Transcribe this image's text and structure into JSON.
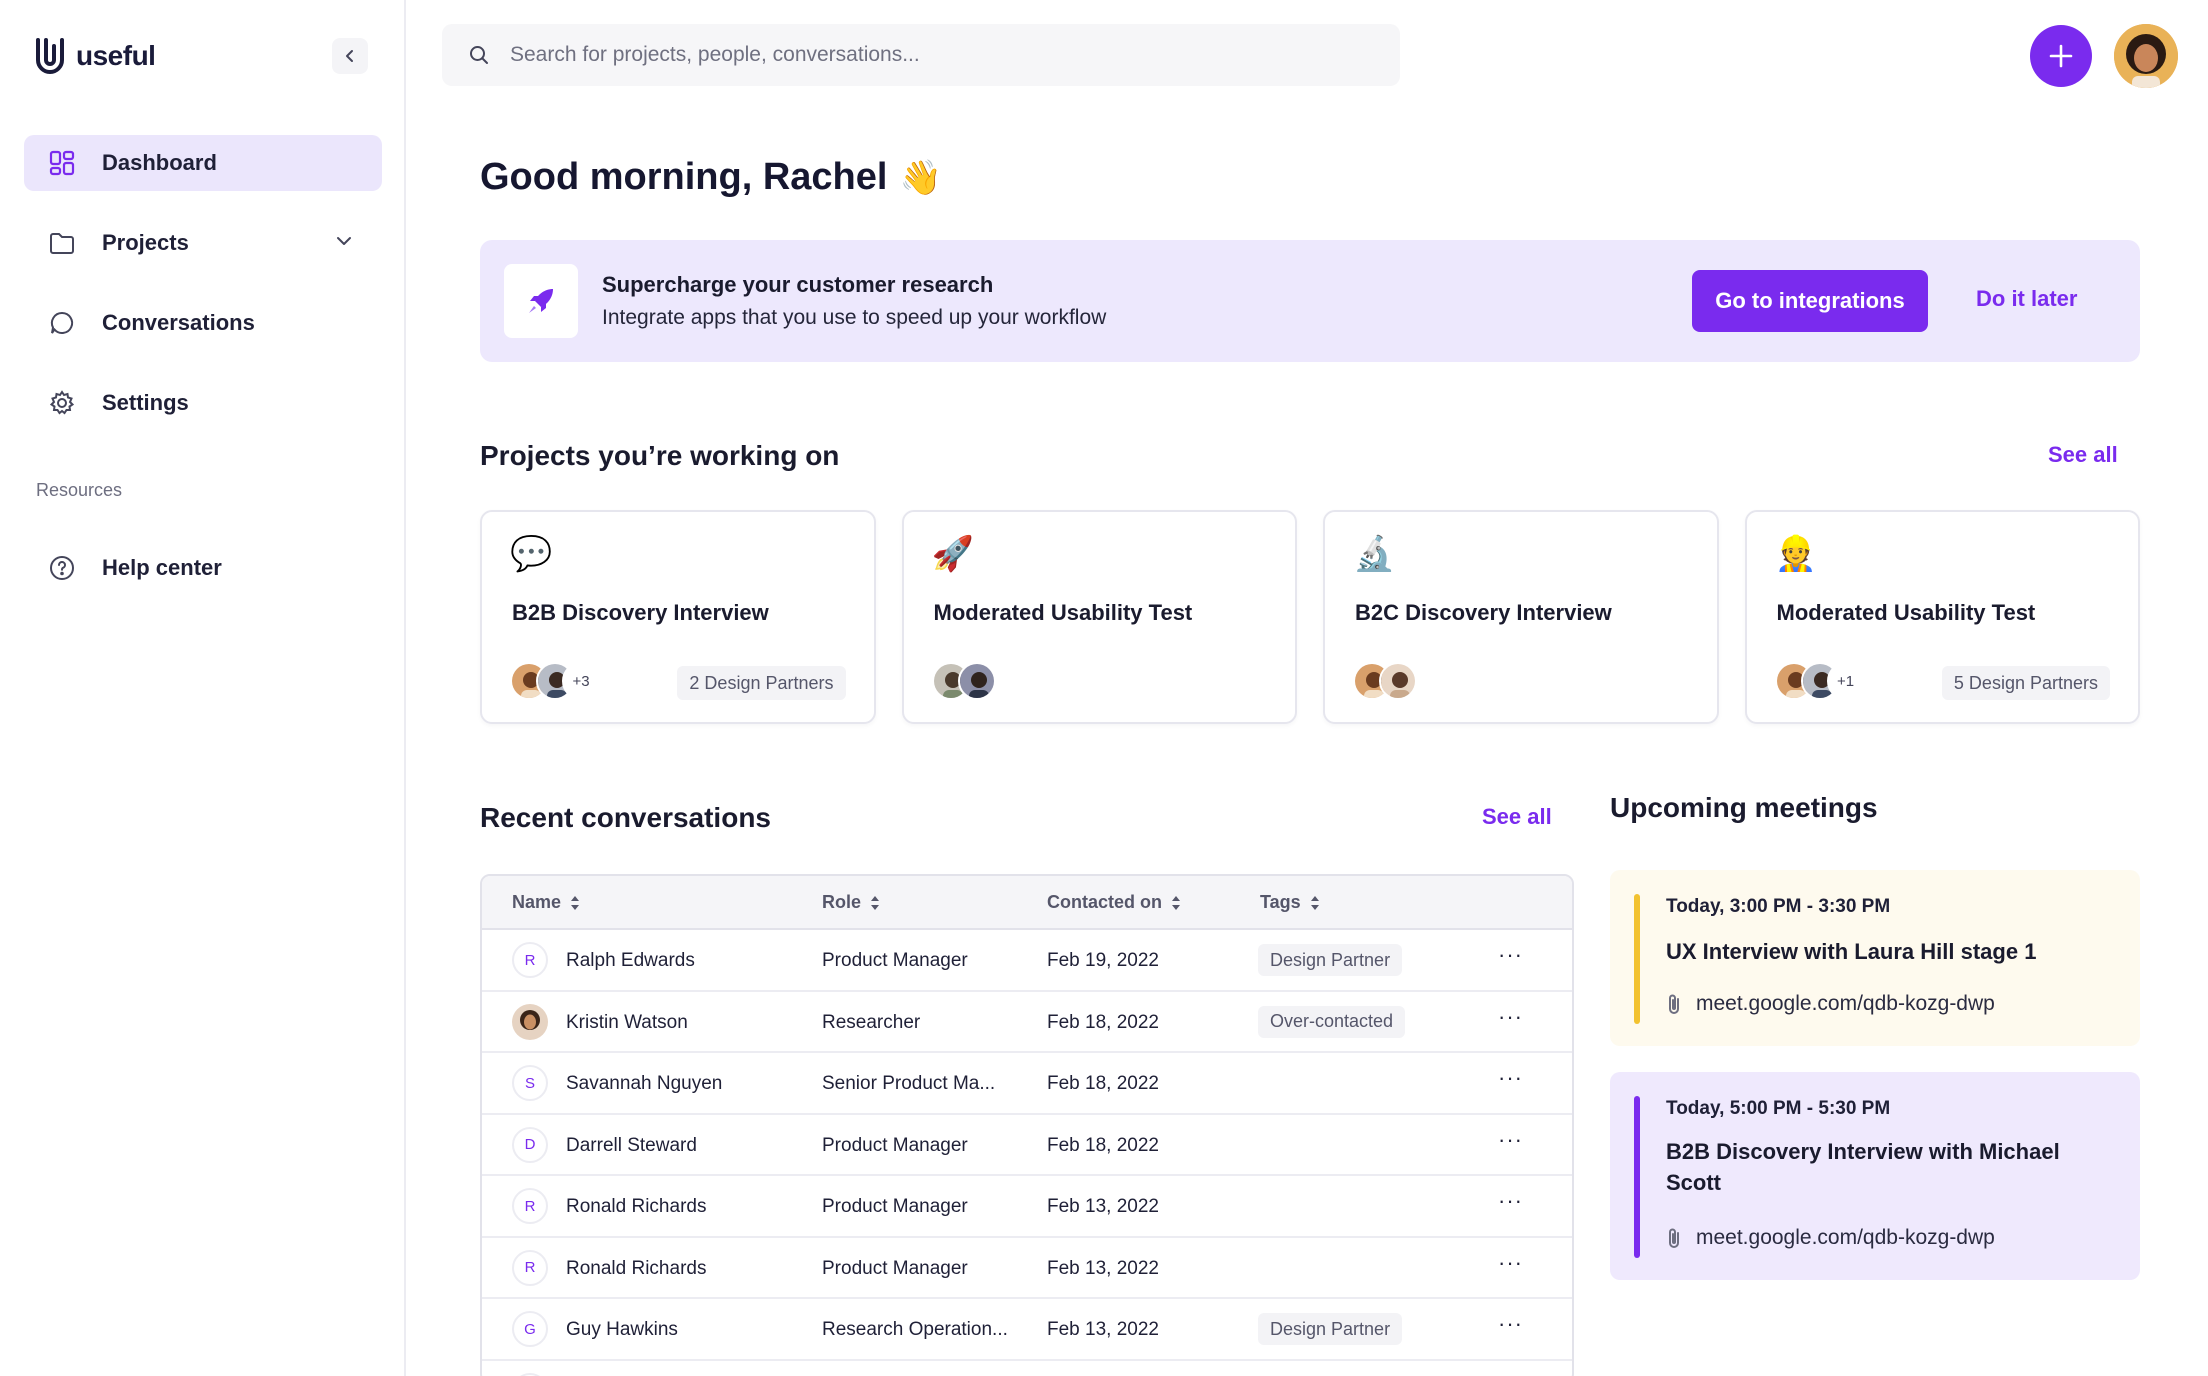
{
  "app": {
    "name": "useful"
  },
  "sidebar": {
    "items": [
      {
        "label": "Dashboard",
        "icon": "dashboard-icon",
        "active": true
      },
      {
        "label": "Projects",
        "icon": "folder-icon"
      },
      {
        "label": "Conversations",
        "icon": "chat-bubble-icon"
      },
      {
        "label": "Settings",
        "icon": "gear-icon"
      }
    ],
    "resources_label": "Resources",
    "help": {
      "label": "Help center",
      "icon": "help-circle-icon"
    }
  },
  "search": {
    "placeholder": "Search for projects, people, conversations..."
  },
  "greeting": {
    "text": "Good morning, Rachel",
    "emoji": "👋"
  },
  "banner": {
    "title": "Supercharge your customer research",
    "subtitle": "Integrate apps that you use to speed up your workflow",
    "primary_label": "Go to integrations",
    "secondary_label": "Do it later"
  },
  "projects": {
    "title": "Projects you’re working on",
    "see_all": "See all",
    "cards": [
      {
        "emoji": "💬",
        "name": "B2B Discovery Interview",
        "more": "+3",
        "partners": "2 Design Partners"
      },
      {
        "emoji": "🚀",
        "name": "Moderated Usability Test",
        "more": "",
        "partners": ""
      },
      {
        "emoji": "🔬",
        "name": "B2C Discovery Interview",
        "more": "",
        "partners": ""
      },
      {
        "emoji": "👷",
        "name": "Moderated Usability Test",
        "more": "+1",
        "partners": "5 Design Partners"
      }
    ]
  },
  "conversations": {
    "title": "Recent conversations",
    "see_all": "See all",
    "columns": [
      "Name",
      "Role",
      "Contacted on",
      "Tags"
    ],
    "rows": [
      {
        "initial": "R",
        "name": "Ralph Edwards",
        "role": "Product Manager",
        "date": "Feb 19, 2022",
        "tag": "Design Partner"
      },
      {
        "initial": "",
        "name": "Kristin Watson",
        "role": "Researcher",
        "date": "Feb 18, 2022",
        "tag": "Over-contacted"
      },
      {
        "initial": "S",
        "name": "Savannah Nguyen",
        "role": "Senior Product Ma...",
        "date": "Feb 18, 2022",
        "tag": ""
      },
      {
        "initial": "D",
        "name": "Darrell Steward",
        "role": "Product Manager",
        "date": "Feb 18, 2022",
        "tag": ""
      },
      {
        "initial": "R",
        "name": "Ronald Richards",
        "role": "Product Manager",
        "date": "Feb 13, 2022",
        "tag": ""
      },
      {
        "initial": "R",
        "name": "Ronald Richards",
        "role": "Product Manager",
        "date": "Feb 13, 2022",
        "tag": ""
      },
      {
        "initial": "G",
        "name": "Guy Hawkins",
        "role": "Research Operation...",
        "date": "Feb 13, 2022",
        "tag": "Design Partner"
      }
    ],
    "more_label": "···"
  },
  "meetings": {
    "title": "Upcoming meetings",
    "items": [
      {
        "time": "Today, 3:00 PM - 3:30 PM",
        "title": "UX Interview with Laura Hill stage 1",
        "link": "meet.google.com/qdb-kozg-dwp",
        "bg": "#fefaee",
        "accent": "#f2c230"
      },
      {
        "time": "Today, 5:00 PM - 5:30 PM",
        "title": "B2B Discovery Interview with Michael Scott",
        "link": "meet.google.com/qdb-kozg-dwp",
        "bg": "#efe9fd",
        "accent": "#7a2bee"
      }
    ]
  },
  "colors": {
    "accent": "#7a2bee",
    "banner_bg": "#ede8fd",
    "active_nav_bg": "#ebe6fc"
  }
}
